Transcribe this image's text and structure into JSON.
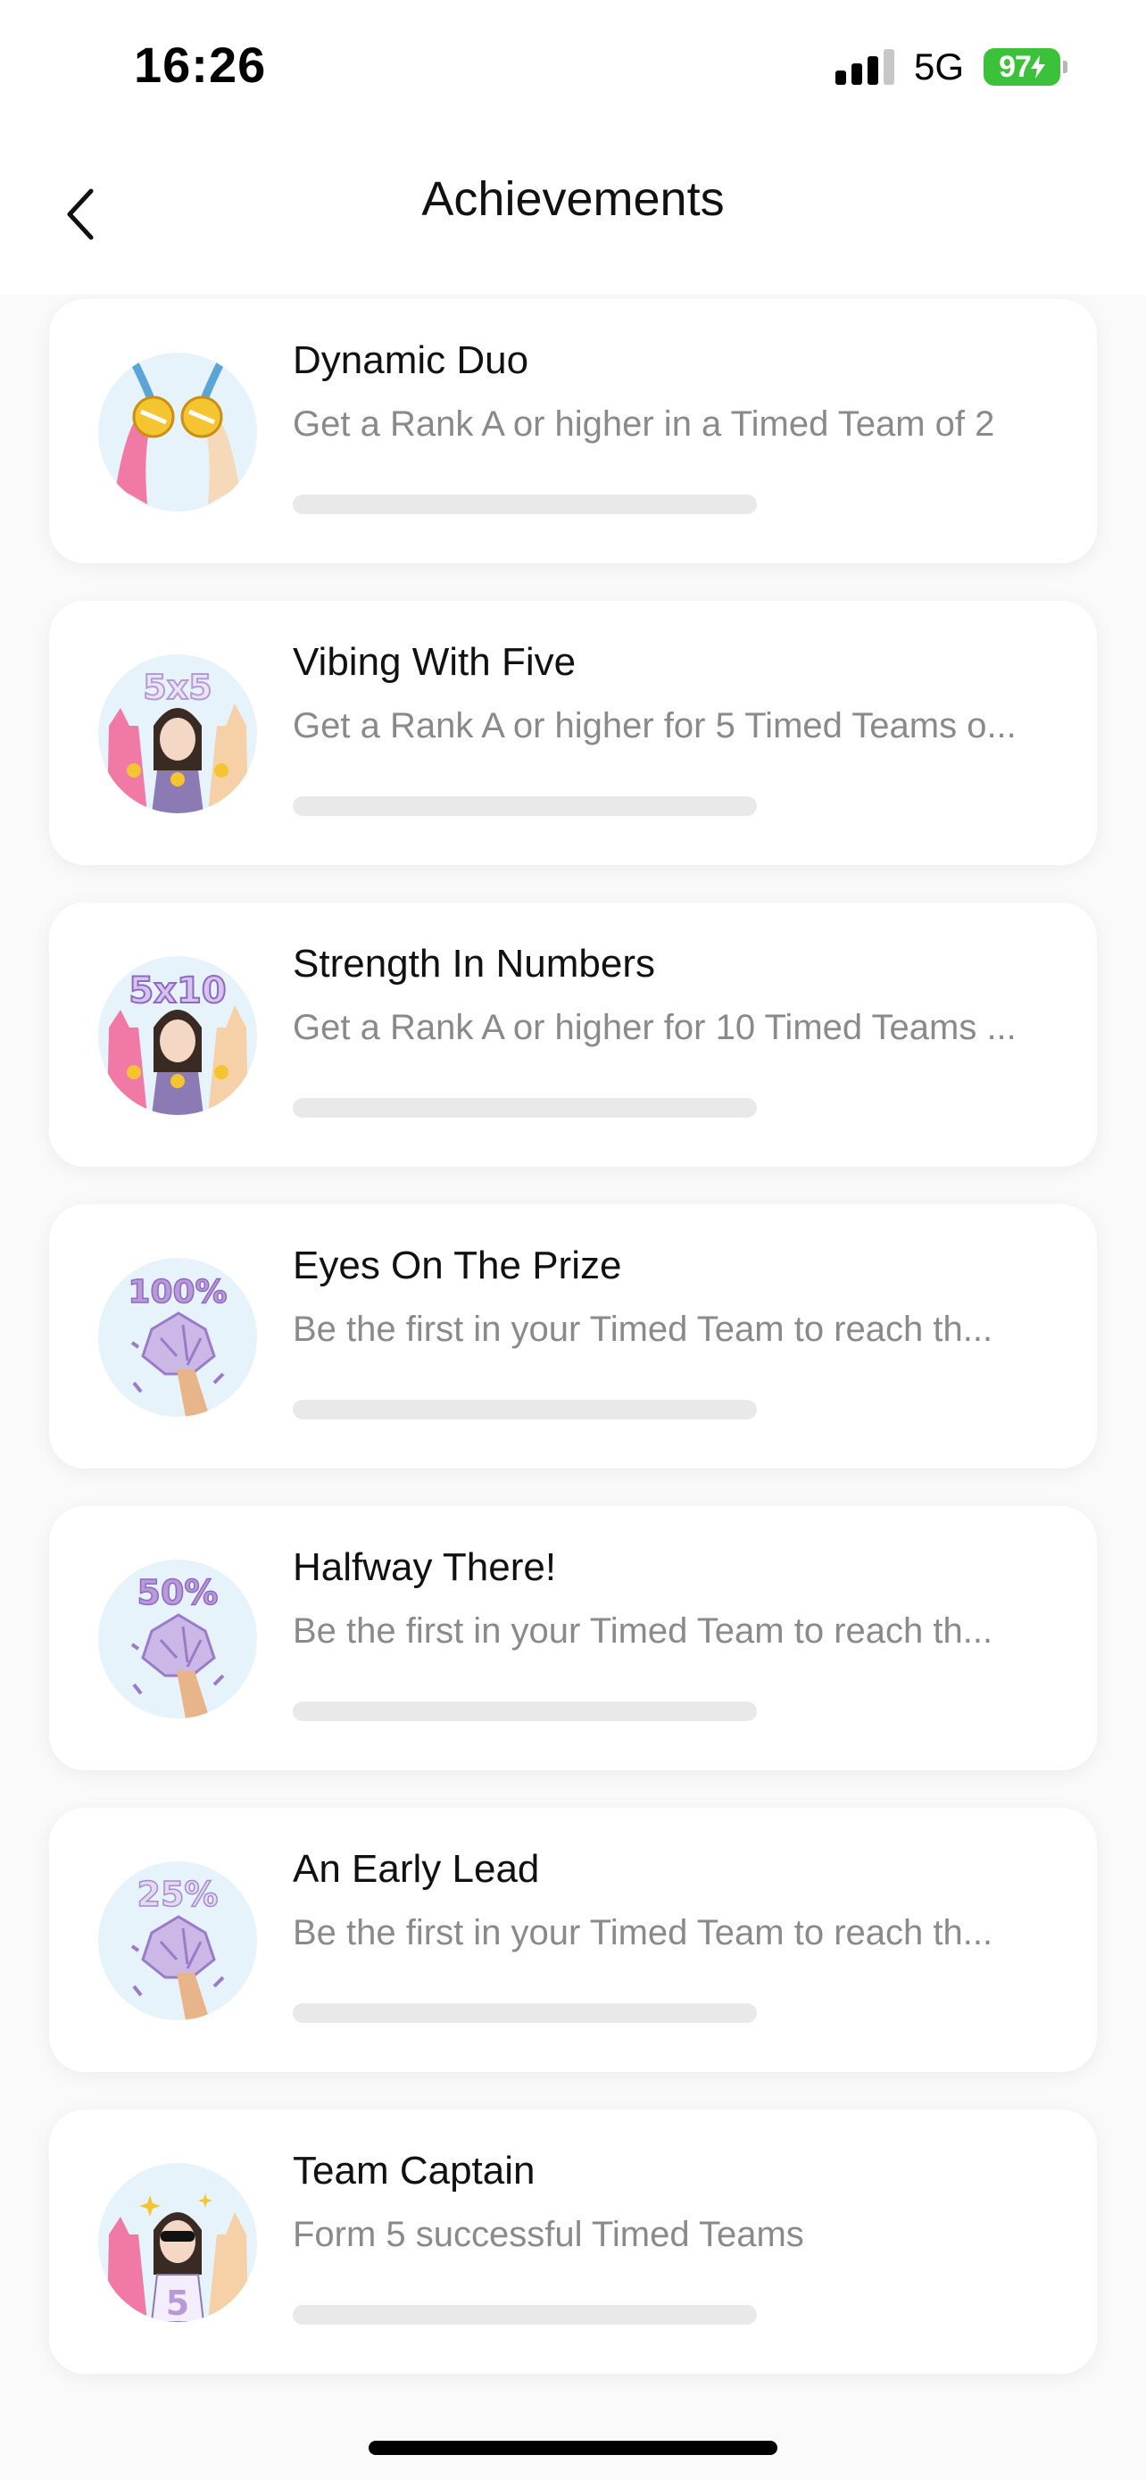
{
  "status_bar": {
    "time": "16:26",
    "network": "5G",
    "battery": "97",
    "icons": [
      "signal-icon",
      "battery-icon",
      "charging-icon"
    ]
  },
  "nav": {
    "title": "Achievements",
    "back_icon": "chevron-left-icon"
  },
  "achievements": [
    {
      "title": "Dynamic Duo",
      "description": "Get a Rank A or higher in a Timed Team of 2",
      "progress": 0,
      "badge": "dynamic-duo-badge"
    },
    {
      "title": "Vibing With Five",
      "description": "Get a Rank A or higher for 5 Timed Teams o...",
      "progress": 0,
      "badge": "vibing-with-five-badge",
      "badge_text": "5x5"
    },
    {
      "title": "Strength In Numbers",
      "description": "Get a Rank A or higher for 10 Timed Teams ...",
      "progress": 0,
      "badge": "strength-in-numbers-badge",
      "badge_text": "5x10"
    },
    {
      "title": "Eyes On The Prize",
      "description": "Be the first in your Timed Team to reach th...",
      "progress": 0,
      "badge": "eyes-on-the-prize-badge",
      "badge_text": "100%"
    },
    {
      "title": "Halfway There!",
      "description": "Be the first in your Timed Team to reach th...",
      "progress": 0,
      "badge": "halfway-there-badge",
      "badge_text": "50%"
    },
    {
      "title": "An Early Lead",
      "description": "Be the first in your Timed Team to reach th...",
      "progress": 0,
      "badge": "an-early-lead-badge",
      "badge_text": "25%"
    },
    {
      "title": "Team Captain",
      "description": "Form 5 successful Timed Teams",
      "progress": 0,
      "badge": "team-captain-badge",
      "badge_text": "5"
    }
  ],
  "colors": {
    "background": "#fafafa",
    "card": "#ffffff",
    "badge_bg": "#e6f3fb",
    "progress_track": "#e9e9e9",
    "battery": "#3cc13a",
    "badge_accent": "#9a7bc8"
  }
}
